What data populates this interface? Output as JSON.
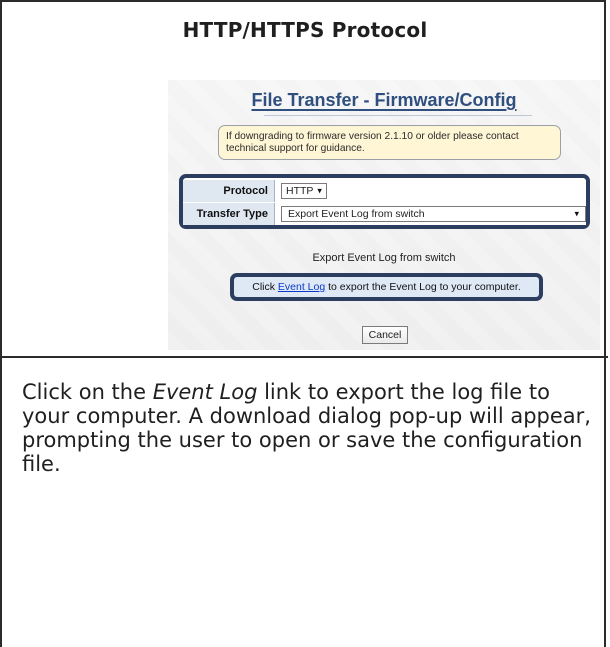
{
  "document": {
    "header_title": "HTTP/HTTPS Protocol",
    "body": {
      "prefix": "Click on the ",
      "emphasis": "Event Log",
      "suffix": " link to export the log file to your computer. A download dialog pop-up will appear, prompting the user to open or save the configuration file."
    }
  },
  "screenshot": {
    "title": "File Transfer - Firmware/Config",
    "notice": "If downgrading to firmware version 2.1.10 or older please contact technical support for guidance.",
    "form": {
      "protocol_label": "Protocol",
      "protocol_value": "HTTP",
      "transfer_type_label": "Transfer Type",
      "transfer_type_value": "Export Event Log from switch"
    },
    "action_heading": "Export Event Log from switch",
    "action": {
      "prefix": "Click ",
      "link": "Event Log",
      "suffix": " to export the Event Log to your computer."
    },
    "cancel_label": "Cancel"
  },
  "icons": {
    "dropdown_caret": "caret-down-icon"
  },
  "colors": {
    "frame": "#2b2b2b",
    "title_blue": "#2f4f7f",
    "box_border": "#2b3e5f",
    "label_bg": "#dfe7f1",
    "notice_bg": "#fff6d6",
    "link": "#0b38c9"
  }
}
